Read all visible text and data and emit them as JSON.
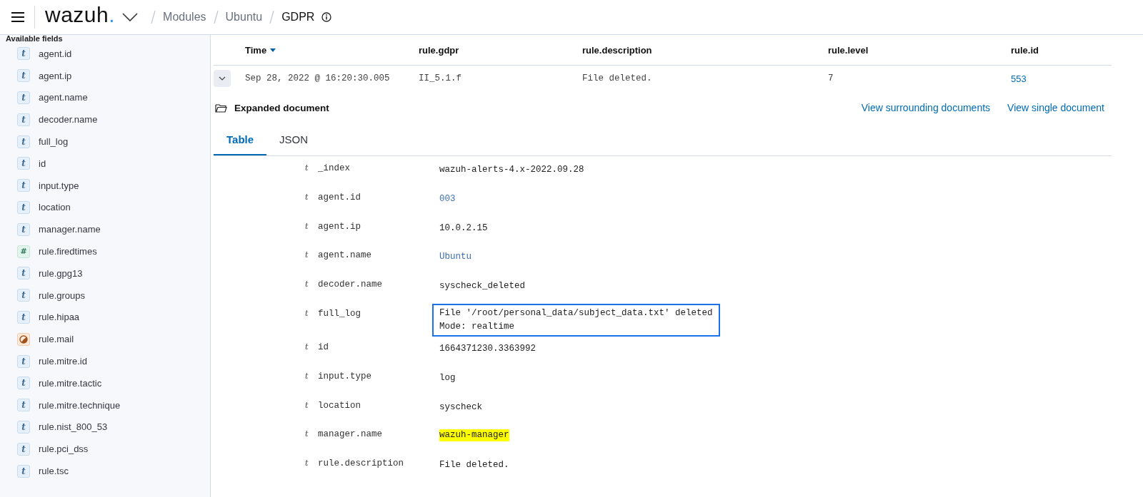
{
  "header": {
    "logo": "wazuh",
    "logo_dot": ".",
    "breadcrumbs": [
      {
        "label": "Modules",
        "current": false
      },
      {
        "label": "Ubuntu",
        "current": false
      },
      {
        "label": "GDPR",
        "current": true
      }
    ]
  },
  "sidebar": {
    "title": "Available fields",
    "fields": [
      {
        "name": "agent.id",
        "kind": "string",
        "glyph": "t"
      },
      {
        "name": "agent.ip",
        "kind": "string",
        "glyph": "t"
      },
      {
        "name": "agent.name",
        "kind": "string",
        "glyph": "t"
      },
      {
        "name": "decoder.name",
        "kind": "string",
        "glyph": "t"
      },
      {
        "name": "full_log",
        "kind": "string",
        "glyph": "t"
      },
      {
        "name": "id",
        "kind": "string",
        "glyph": "t"
      },
      {
        "name": "input.type",
        "kind": "string",
        "glyph": "t"
      },
      {
        "name": "location",
        "kind": "string",
        "glyph": "t"
      },
      {
        "name": "manager.name",
        "kind": "string",
        "glyph": "t"
      },
      {
        "name": "rule.firedtimes",
        "kind": "number",
        "glyph": "#"
      },
      {
        "name": "rule.gpg13",
        "kind": "string",
        "glyph": "t"
      },
      {
        "name": "rule.groups",
        "kind": "string",
        "glyph": "t"
      },
      {
        "name": "rule.hipaa",
        "kind": "string",
        "glyph": "t"
      },
      {
        "name": "rule.mail",
        "kind": "boolean"
      },
      {
        "name": "rule.mitre.id",
        "kind": "string",
        "glyph": "t"
      },
      {
        "name": "rule.mitre.tactic",
        "kind": "string",
        "glyph": "t"
      },
      {
        "name": "rule.mitre.technique",
        "kind": "string",
        "glyph": "t"
      },
      {
        "name": "rule.nist_800_53",
        "kind": "string",
        "glyph": "t"
      },
      {
        "name": "rule.pci_dss",
        "kind": "string",
        "glyph": "t"
      },
      {
        "name": "rule.tsc",
        "kind": "string",
        "glyph": "t"
      }
    ]
  },
  "table": {
    "columns": [
      {
        "label": "Time",
        "sorted": true
      },
      {
        "label": "rule.gdpr",
        "sorted": false
      },
      {
        "label": "rule.description",
        "sorted": false
      },
      {
        "label": "rule.level",
        "sorted": false
      },
      {
        "label": "rule.id",
        "sorted": false
      }
    ],
    "rows": [
      {
        "expanded": true,
        "cells": [
          {
            "text": "Sep 28, 2022 @ 16:20:30.005",
            "kind": "text"
          },
          {
            "text": "II_5.1.f",
            "kind": "text"
          },
          {
            "text": "File deleted.",
            "kind": "text"
          },
          {
            "text": "7",
            "kind": "text"
          },
          {
            "text": "553",
            "kind": "link"
          }
        ]
      }
    ]
  },
  "expanded_document": {
    "title": "Expanded document",
    "links": [
      "View surrounding documents",
      "View single document"
    ],
    "tabs": [
      {
        "label": "Table",
        "selected": true
      },
      {
        "label": "JSON",
        "selected": false
      }
    ],
    "fields": [
      {
        "glyph": "t",
        "name": "_index",
        "kind": "text",
        "lines": [
          "wazuh-alerts-4.x-2022.09.28"
        ]
      },
      {
        "glyph": "t",
        "name": "agent.id",
        "kind": "link",
        "lines": [
          "003"
        ]
      },
      {
        "glyph": "t",
        "name": "agent.ip",
        "kind": "text",
        "lines": [
          "10.0.2.15"
        ]
      },
      {
        "glyph": "t",
        "name": "agent.name",
        "kind": "link",
        "lines": [
          "Ubuntu"
        ]
      },
      {
        "glyph": "t",
        "name": "decoder.name",
        "kind": "text",
        "lines": [
          "syscheck_deleted"
        ]
      },
      {
        "glyph": "t",
        "name": "full_log",
        "kind": "boxed",
        "lines": [
          "File '/root/personal_data/subject_data.txt' deleted",
          "Mode: realtime"
        ]
      },
      {
        "glyph": "t",
        "name": "id",
        "kind": "text",
        "lines": [
          "1664371230.3363992"
        ]
      },
      {
        "glyph": "t",
        "name": "input.type",
        "kind": "text",
        "lines": [
          "log"
        ]
      },
      {
        "glyph": "t",
        "name": "location",
        "kind": "text",
        "lines": [
          "syscheck"
        ]
      },
      {
        "glyph": "t",
        "name": "manager.name",
        "kind": "highlighted",
        "lines": [
          "wazuh-manager"
        ]
      },
      {
        "glyph": "t",
        "name": "rule.description",
        "kind": "text",
        "lines": [
          "File deleted."
        ]
      }
    ]
  }
}
